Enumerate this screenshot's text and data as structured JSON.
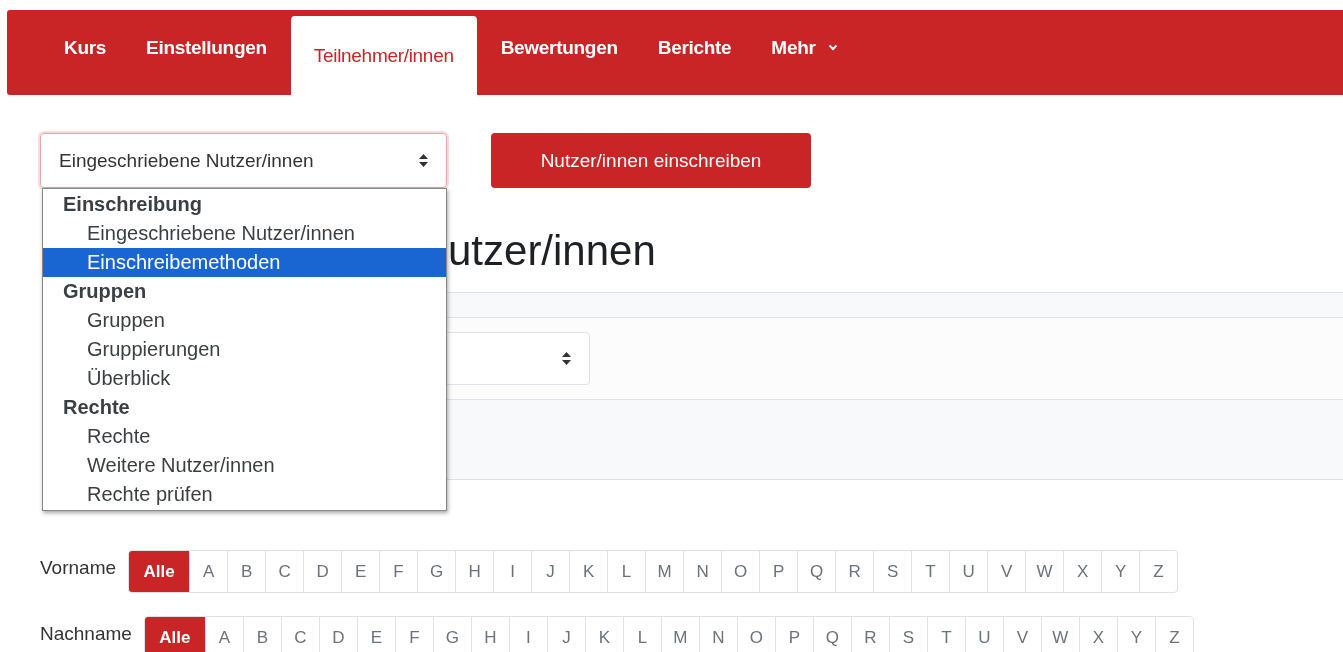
{
  "nav": {
    "tabs": [
      {
        "label": "Kurs",
        "kind": "link",
        "selected": false
      },
      {
        "label": "Einstellungen",
        "kind": "link",
        "selected": false
      },
      {
        "label": "Teilnehmer/innen",
        "kind": "link",
        "selected": true
      },
      {
        "label": "Bewertungen",
        "kind": "link",
        "selected": false
      },
      {
        "label": "Berichte",
        "kind": "link",
        "selected": false
      },
      {
        "label": "Mehr",
        "kind": "menu",
        "selected": false
      }
    ]
  },
  "toolbar": {
    "select": {
      "value": "Eingeschriebene Nutzer/innen"
    },
    "button": "Nutzer/innen einschreiben"
  },
  "dropdown": {
    "groups": [
      {
        "label": "Einschreibung",
        "options": [
          {
            "label": "Eingeschriebene Nutzer/innen",
            "selected": false
          },
          {
            "label": "Einschreibemethoden",
            "selected": true
          }
        ]
      },
      {
        "label": "Gruppen",
        "options": [
          {
            "label": "Gruppen",
            "selected": false
          },
          {
            "label": "Gruppierungen",
            "selected": false
          },
          {
            "label": "Überblick",
            "selected": false
          }
        ]
      },
      {
        "label": "Rechte",
        "options": [
          {
            "label": "Rechte",
            "selected": false
          },
          {
            "label": "Weitere Nutzer/innen",
            "selected": false
          },
          {
            "label": "Rechte prüfen",
            "selected": false
          }
        ]
      }
    ]
  },
  "heading": "utzer/innen",
  "initials_bars": [
    {
      "label": "Vorname",
      "options": [
        {
          "label": "Alle",
          "selected": true
        },
        {
          "label": "A",
          "selected": false
        },
        {
          "label": "B",
          "selected": false
        },
        {
          "label": "C",
          "selected": false
        },
        {
          "label": "D",
          "selected": false
        },
        {
          "label": "E",
          "selected": false
        },
        {
          "label": "F",
          "selected": false
        },
        {
          "label": "G",
          "selected": false
        },
        {
          "label": "H",
          "selected": false
        },
        {
          "label": "I",
          "selected": false
        },
        {
          "label": "J",
          "selected": false
        },
        {
          "label": "K",
          "selected": false
        },
        {
          "label": "L",
          "selected": false
        },
        {
          "label": "M",
          "selected": false
        },
        {
          "label": "N",
          "selected": false
        },
        {
          "label": "O",
          "selected": false
        },
        {
          "label": "P",
          "selected": false
        },
        {
          "label": "Q",
          "selected": false
        },
        {
          "label": "R",
          "selected": false
        },
        {
          "label": "S",
          "selected": false
        },
        {
          "label": "T",
          "selected": false
        },
        {
          "label": "U",
          "selected": false
        },
        {
          "label": "V",
          "selected": false
        },
        {
          "label": "W",
          "selected": false
        },
        {
          "label": "X",
          "selected": false
        },
        {
          "label": "Y",
          "selected": false
        },
        {
          "label": "Z",
          "selected": false
        }
      ]
    },
    {
      "label": "Nachname",
      "options": [
        {
          "label": "Alle",
          "selected": true
        },
        {
          "label": "A",
          "selected": false
        },
        {
          "label": "B",
          "selected": false
        },
        {
          "label": "C",
          "selected": false
        },
        {
          "label": "D",
          "selected": false
        },
        {
          "label": "E",
          "selected": false
        },
        {
          "label": "F",
          "selected": false
        },
        {
          "label": "G",
          "selected": false
        },
        {
          "label": "H",
          "selected": false
        },
        {
          "label": "I",
          "selected": false
        },
        {
          "label": "J",
          "selected": false
        },
        {
          "label": "K",
          "selected": false
        },
        {
          "label": "L",
          "selected": false
        },
        {
          "label": "M",
          "selected": false
        },
        {
          "label": "N",
          "selected": false
        },
        {
          "label": "O",
          "selected": false
        },
        {
          "label": "P",
          "selected": false
        },
        {
          "label": "Q",
          "selected": false
        },
        {
          "label": "R",
          "selected": false
        },
        {
          "label": "S",
          "selected": false
        },
        {
          "label": "T",
          "selected": false
        },
        {
          "label": "U",
          "selected": false
        },
        {
          "label": "V",
          "selected": false
        },
        {
          "label": "W",
          "selected": false
        },
        {
          "label": "X",
          "selected": false
        },
        {
          "label": "Y",
          "selected": false
        },
        {
          "label": "Z",
          "selected": false
        }
      ]
    }
  ]
}
